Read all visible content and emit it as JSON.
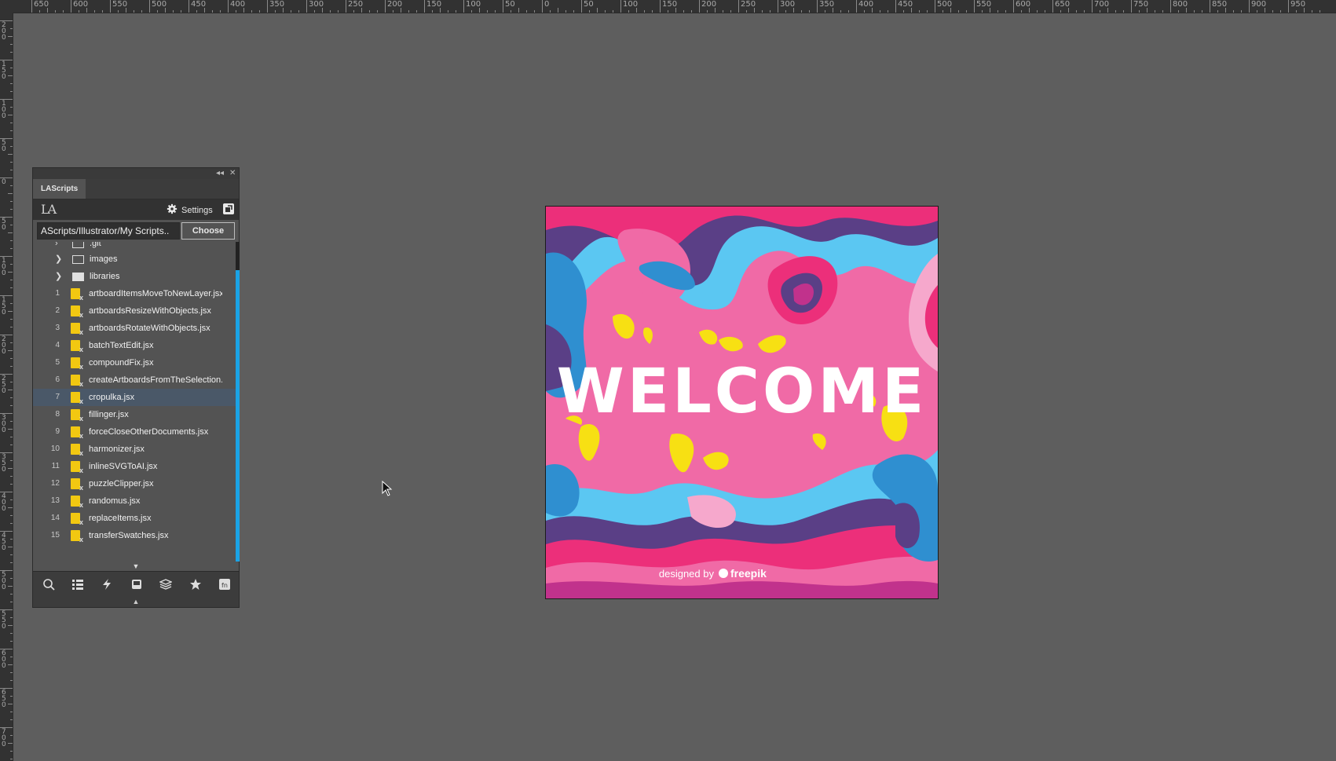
{
  "ruler": {
    "top_labels": [
      "650",
      "600",
      "550",
      "500",
      "450",
      "400",
      "350",
      "300",
      "250",
      "200",
      "150",
      "100",
      "50",
      "0",
      "50",
      "100",
      "150",
      "200",
      "250",
      "300",
      "350",
      "400",
      "450",
      "500",
      "550",
      "600",
      "650",
      "700",
      "750",
      "800",
      "850",
      "900",
      "950"
    ],
    "left_labels": [
      "200",
      "150",
      "100",
      "50",
      "0",
      "50",
      "100",
      "150",
      "200",
      "250",
      "300",
      "350",
      "400",
      "450",
      "500",
      "550",
      "600",
      "650",
      "700"
    ]
  },
  "panel": {
    "tab_label": "LAScripts",
    "logo": "LA",
    "settings_label": "Settings",
    "path_value": "..AScripts/Illustrator/My Scripts",
    "choose_label": "Choose",
    "folders": [
      {
        "name": ".git",
        "icon": "folder-outline-icon"
      },
      {
        "name": "images",
        "icon": "folder-outline-icon"
      },
      {
        "name": "libraries",
        "icon": "folder-filled-icon"
      }
    ],
    "scripts": [
      {
        "num": "1",
        "name": "artboardItemsMoveToNewLayer.jsx"
      },
      {
        "num": "2",
        "name": "artboardsResizeWithObjects.jsx"
      },
      {
        "num": "3",
        "name": "artboardsRotateWithObjects.jsx"
      },
      {
        "num": "4",
        "name": "batchTextEdit.jsx"
      },
      {
        "num": "5",
        "name": "compoundFix.jsx"
      },
      {
        "num": "6",
        "name": "createArtboardsFromTheSelection.jsx"
      },
      {
        "num": "7",
        "name": "cropulka.jsx"
      },
      {
        "num": "8",
        "name": "fillinger.jsx"
      },
      {
        "num": "9",
        "name": "forceCloseOtherDocuments.jsx"
      },
      {
        "num": "10",
        "name": "harmonizer.jsx"
      },
      {
        "num": "11",
        "name": "inlineSVGToAI.jsx"
      },
      {
        "num": "12",
        "name": "puzzleClipper.jsx"
      },
      {
        "num": "13",
        "name": "randomus.jsx"
      },
      {
        "num": "14",
        "name": "replaceItems.jsx"
      },
      {
        "num": "15",
        "name": "transferSwatches.jsx"
      }
    ],
    "selected_script": "cropulka.jsx",
    "bottom_icons": [
      "search-icon",
      "list-icon",
      "lightning-icon",
      "inbox-icon",
      "layers-icon",
      "star-icon",
      "fn-icon"
    ]
  },
  "artwork": {
    "headline": "WELCOME",
    "credit_prefix": "designed by",
    "credit_brand": "freepik",
    "colors": {
      "pink": "#f06aa6",
      "hotpink": "#ec2f7a",
      "purple": "#5a3f86",
      "blue": "#5bc7f2",
      "deepblue": "#2f8fd0",
      "lightpink": "#f6a8cc",
      "yellow": "#f7e013"
    }
  }
}
